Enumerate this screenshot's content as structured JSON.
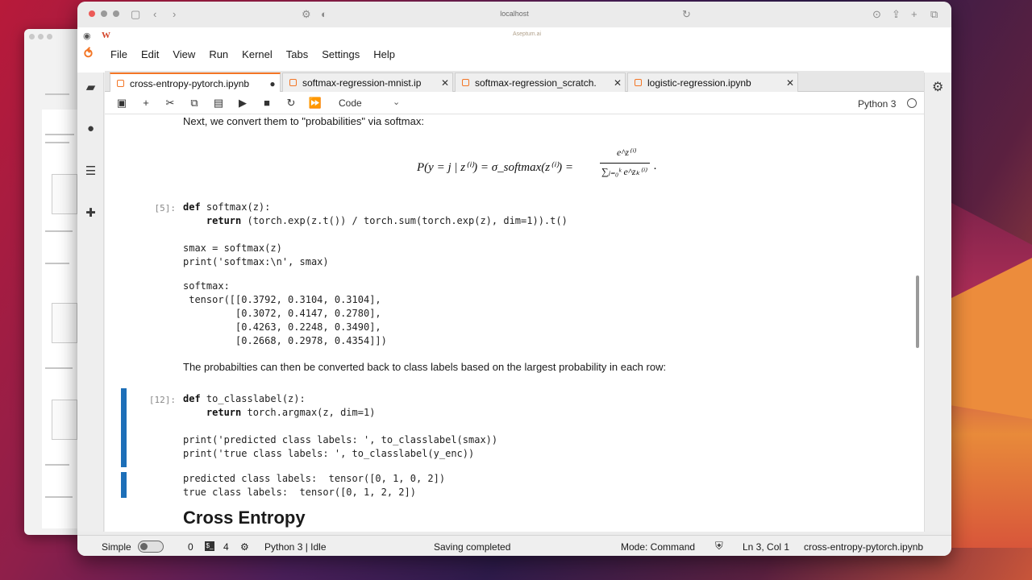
{
  "browser": {
    "url": "localhost",
    "subtitle": "Aseptum.ai"
  },
  "menu": [
    "File",
    "Edit",
    "View",
    "Run",
    "Kernel",
    "Tabs",
    "Settings",
    "Help"
  ],
  "tabs": [
    {
      "label": "cross-entropy-pytorch.ipynb",
      "close": "●",
      "active": true
    },
    {
      "label": "softmax-regression-mnist.ip",
      "close": "✕",
      "active": false
    },
    {
      "label": "softmax-regression_scratch.",
      "close": "✕",
      "active": false
    },
    {
      "label": "logistic-regression.ipynb",
      "close": "✕",
      "active": false
    }
  ],
  "toolbar": {
    "cell_type": "Code",
    "kernel": "Python 3"
  },
  "notebook": {
    "md_intro": "Next, we convert them to \"probabilities\" via softmax:",
    "formula_lhs": "P(y = j | z⁽ⁱ⁾) = σ_softmax(z⁽ⁱ⁾) =",
    "formula_num": "e^z⁽ⁱ⁾",
    "formula_den": "∑ⱼ₌₀ᵏ e^zₖ⁽ⁱ⁾",
    "cell5_prompt": "[5]:",
    "cell5_line1_kw": "def",
    "cell5_line1": " softmax(z):",
    "cell5_line2_kw": "    return",
    "cell5_line2": " (torch.exp(z.t()) / torch.sum(torch.exp(z), dim=1)).t()",
    "cell5_line3": "smax = softmax(z)",
    "cell5_line4": "print('softmax:\\n', smax)",
    "cell5_out": "softmax:\n tensor([[0.3792, 0.3104, 0.3104],\n         [0.3072, 0.4147, 0.2780],\n         [0.4263, 0.2248, 0.3490],\n         [0.2668, 0.2978, 0.4354]])",
    "md_probs": "The probabilties can then be converted back to class labels based on the largest probability in each row:",
    "cell12_prompt": "[12]:",
    "cell12_line1_kw": "def",
    "cell12_line1": " to_classlabel(z):",
    "cell12_line2_kw": "    return",
    "cell12_line2": " torch.argmax(z, dim=1)",
    "cell12_line3": "print('predicted class labels: ', to_classlabel(smax))",
    "cell12_line4": "print('true class labels: ', to_classlabel(y_enc))",
    "cell12_out": "predicted class labels:  tensor([0, 1, 0, 2])\ntrue class labels:  tensor([0, 1, 2, 2])",
    "heading": "Cross Entropy"
  },
  "status": {
    "mode_label": "Simple",
    "count_a": "0",
    "count_b": "4",
    "kernel_state": "Python 3 | Idle",
    "saving": "Saving completed",
    "mode": "Mode: Command",
    "cursor": "Ln 3, Col 1",
    "filename": "cross-entropy-pytorch.ipynb"
  }
}
